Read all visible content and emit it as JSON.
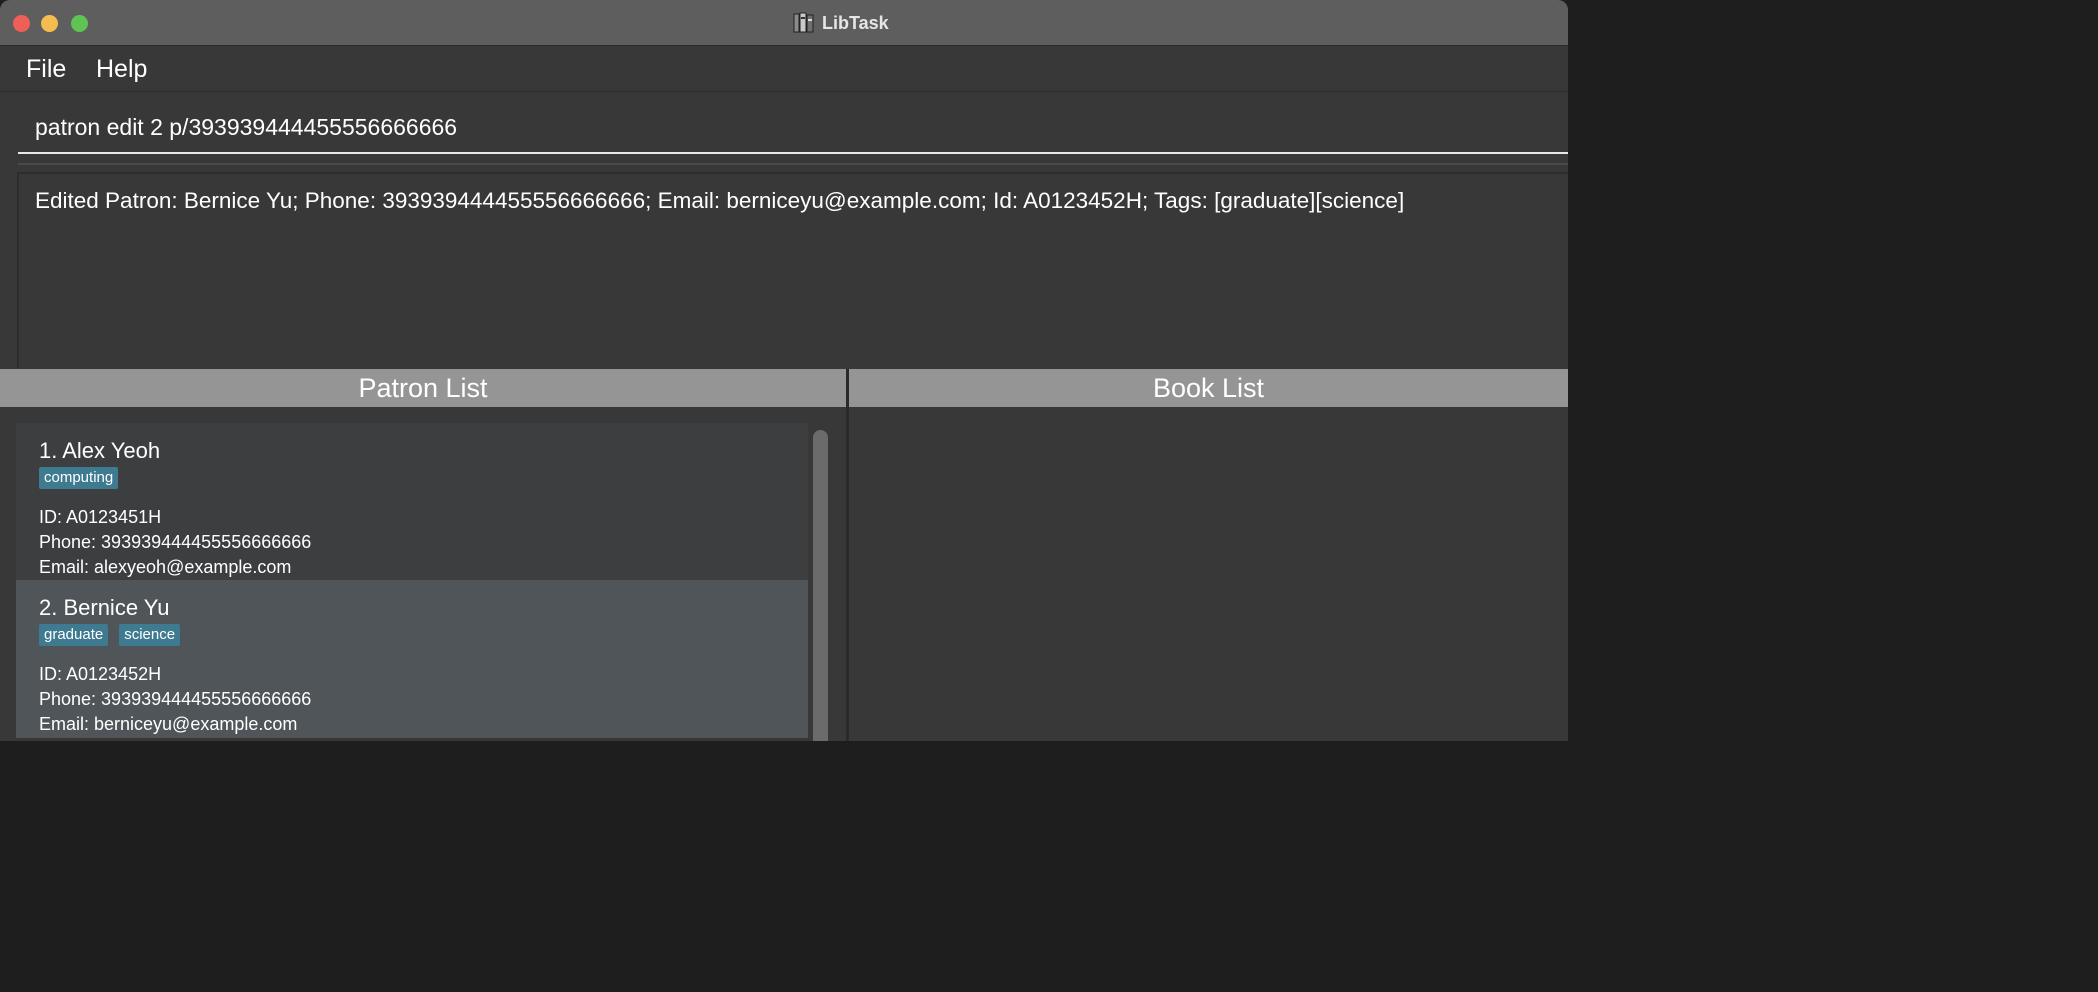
{
  "window": {
    "title": "LibTask"
  },
  "menu": {
    "file": "File",
    "help": "Help"
  },
  "command": {
    "value": "patron edit 2 p/393939444455556666666"
  },
  "result": {
    "text": "Edited Patron: Bernice Yu; Phone: 393939444455556666666; Email: berniceyu@example.com; Id: A0123452H; Tags: [graduate][science]"
  },
  "panels": {
    "patron_header": "Patron List",
    "book_header": "Book List"
  },
  "patrons": [
    {
      "name": "1.  Alex Yeoh",
      "tags": [
        "computing"
      ],
      "id": "ID: A0123451H",
      "phone": "Phone: 393939444455556666666",
      "email": "Email: alexyeoh@example.com"
    },
    {
      "name": "2.  Bernice Yu",
      "tags": [
        "graduate",
        "science"
      ],
      "id": "ID: A0123452H",
      "phone": "Phone: 393939444455556666666",
      "email": "Email: berniceyu@example.com"
    }
  ],
  "colors": {
    "background": "#383838",
    "titlebar": "#5e5e5e",
    "header": "#959595",
    "tag": "#3e7b91",
    "card_selected": "#4f5558"
  }
}
